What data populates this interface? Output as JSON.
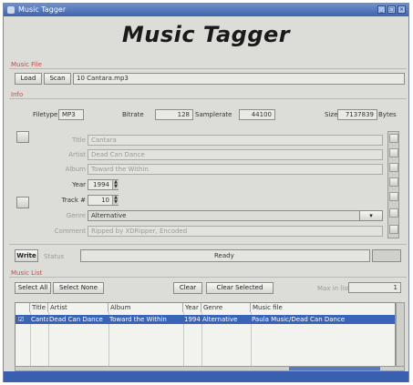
{
  "window": {
    "title": "Music Tagger"
  },
  "app_title": "Music Tagger",
  "music_file": {
    "section_label": "Music File",
    "load_label": "Load",
    "scan_label": "Scan",
    "path": "10 Cantara.mp3"
  },
  "info": {
    "section_label": "Info",
    "filetype_label": "Filetype",
    "filetype_value": "MP3",
    "bitrate_label": "Bitrate",
    "bitrate_value": "128",
    "samplerate_label": "Samplerate",
    "samplerate_value": "44100",
    "size_label": "Size",
    "size_value": "7137839",
    "size_unit": "Bytes"
  },
  "tags": {
    "title_label": "Title",
    "title_value": "Cantara",
    "artist_label": "Artist",
    "artist_value": "Dead Can Dance",
    "album_label": "Album",
    "album_value": "Toward the Within",
    "year_label": "Year",
    "year_value": "1994",
    "track_label": "Track #",
    "track_value": "10",
    "genre_label": "Genre",
    "genre_value": "Alternative",
    "comment_label": "Comment",
    "comment_value": "Ripped by XDRipper, Encoded"
  },
  "write": {
    "write_label": "Write",
    "status_label": "Status",
    "status_value": "Ready"
  },
  "music_list": {
    "section_label": "Music List",
    "select_all_label": "Select All",
    "select_none_label": "Select None",
    "clear_label": "Clear",
    "clear_selected_label": "Clear Selected",
    "max_label": "Max in list",
    "max_value": "1",
    "columns": [
      "Title",
      "Artist",
      "Album",
      "Year",
      "Genre",
      "Music file"
    ],
    "rows": [
      {
        "title": "Cantara",
        "artist": "Dead Can Dance",
        "album": "Toward the Within",
        "year": "1994",
        "genre": "Alternative",
        "file": "Paula Music/Dead Can Dance"
      }
    ]
  },
  "colors": {
    "section_label": "#c0504d",
    "selection": "#3a64b8",
    "titlebar": "#4f73b8"
  }
}
